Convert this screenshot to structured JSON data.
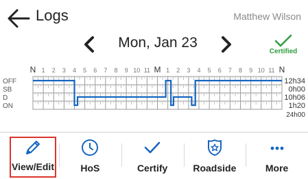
{
  "header": {
    "title": "Logs",
    "user_name": "Matthew Wilson"
  },
  "date_nav": {
    "date": "Mon, Jan 23",
    "status_label": "Certified"
  },
  "graph": {
    "hour_labels": [
      "N",
      "1",
      "2",
      "3",
      "4",
      "5",
      "6",
      "7",
      "8",
      "9",
      "10",
      "11",
      "M",
      "1",
      "2",
      "3",
      "4",
      "5",
      "6",
      "7",
      "8",
      "9",
      "10",
      "11",
      "N"
    ],
    "rows": [
      {
        "label": "OFF",
        "total": "12h34"
      },
      {
        "label": "SB",
        "total": "0h00"
      },
      {
        "label": "D",
        "total": "10h06"
      },
      {
        "label": "ON",
        "total": "1h20"
      }
    ],
    "grand_total": "24h00",
    "status_segments": [
      {
        "status": "OFF",
        "start": 0,
        "end": 4.0
      },
      {
        "status": "ON",
        "start": 4.0,
        "end": 4.3
      },
      {
        "status": "D",
        "start": 4.3,
        "end": 12.8
      },
      {
        "status": "OFF",
        "start": 12.8,
        "end": 13.3
      },
      {
        "status": "ON",
        "start": 13.3,
        "end": 13.55
      },
      {
        "status": "D",
        "start": 13.55,
        "end": 15.3
      },
      {
        "status": "ON",
        "start": 15.3,
        "end": 15.65
      },
      {
        "status": "OFF",
        "start": 15.65,
        "end": 24
      }
    ],
    "line_color": "#1565c0"
  },
  "tabs": [
    {
      "label": "View/Edit",
      "icon": "pencil-icon"
    },
    {
      "label": "HoS",
      "icon": "clock-icon"
    },
    {
      "label": "Certify",
      "icon": "checkmark-icon"
    },
    {
      "label": "Roadside",
      "icon": "police-badge-icon"
    },
    {
      "label": "More",
      "icon": "more-dots-icon"
    }
  ],
  "colors": {
    "accent": "#1565c0",
    "certified": "#2e9e3e",
    "selected_outline": "#d9352b"
  }
}
